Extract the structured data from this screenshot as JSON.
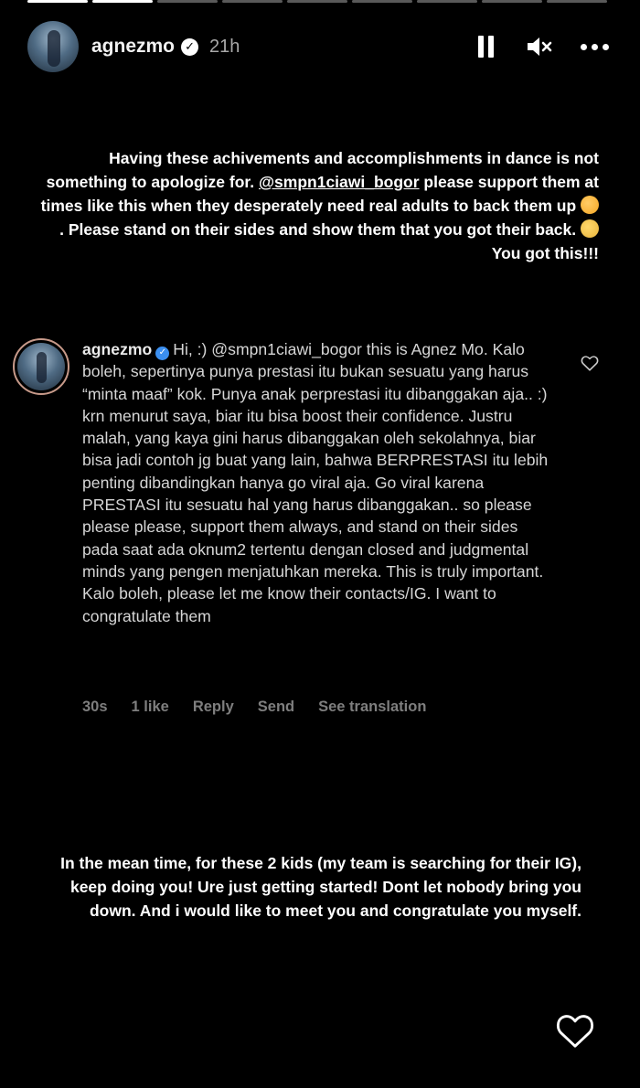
{
  "story": {
    "segments": [
      true,
      true,
      false,
      false,
      false,
      false,
      false,
      false,
      false
    ],
    "username": "agnezmo",
    "time": "21h",
    "text1_part1": "Having these achivements and accomplishments in dance is not something to apologize for. ",
    "text1_mention": "@smpn1ciawi_bogor",
    "text1_part2": " please support them at times like this when they desperately need real adults to back them up ",
    "text1_part3": ". Please stand on their sides and show them that you got their back. ",
    "text1_part4": "You got this!!!",
    "text2": "In the mean time, for these 2 kids (my team is searching for their IG), keep doing you! Ure just getting started! Dont let nobody bring you down. And i would like to meet you and congratulate you myself."
  },
  "comment": {
    "username": "agnezmo",
    "text": "Hi, :) @smpn1ciawi_bogor this is Agnez Mo. Kalo boleh, sepertinya punya prestasi itu bukan sesuatu yang harus “minta maaf” kok. Punya anak perprestasi itu dibanggakan aja.. :) krn menurut saya, biar itu bisa boost their confidence. Justru malah, yang kaya gini harus dibanggakan oleh sekolahnya, biar bisa jadi contoh jg buat yang lain, bahwa BERPRESTASI itu lebih penting dibandingkan hanya go viral aja. Go viral karena PRESTASI itu sesuatu hal yang harus dibanggakan.. so please please please, support them always, and stand on their sides pada saat ada oknum2 tertentu dengan closed and judgmental minds yang pengen menjatuhkan mereka. This is truly important. Kalo boleh, please let me know their contacts/IG. I want to congratulate them",
    "age": "30s",
    "likes": "1 like",
    "reply_label": "Reply",
    "send_label": "Send",
    "translate_label": "See translation"
  },
  "icons": {
    "verified": "verified-badge-icon",
    "pause": "pause-icon",
    "mute": "mute-icon",
    "more": "more-icon",
    "like": "heart-icon"
  }
}
